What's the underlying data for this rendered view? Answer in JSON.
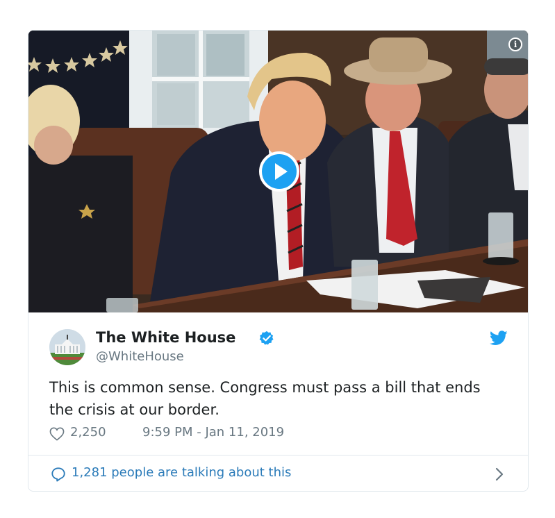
{
  "tweet": {
    "author_name": "The White House",
    "author_handle": "@WhiteHouse",
    "text": "This is common sense. Congress must pass a bill that ends the crisis at our border.",
    "likes": "2,250",
    "timestamp": "9:59 PM - Jan 11, 2019",
    "talking_text": "1,281 people are talking about this"
  },
  "icons": {
    "play": "play-icon",
    "info": "info-icon",
    "verified": "verified-badge-icon",
    "brand": "twitter-bird-icon",
    "like": "heart-icon",
    "reply": "reply-icon",
    "more": "chevron-right-icon"
  },
  "colors": {
    "brand_blue": "#1da1f2",
    "text_primary": "#1c2022",
    "text_secondary": "#697882",
    "link_blue": "#2b7bb9",
    "border": "#e1e8ed"
  }
}
